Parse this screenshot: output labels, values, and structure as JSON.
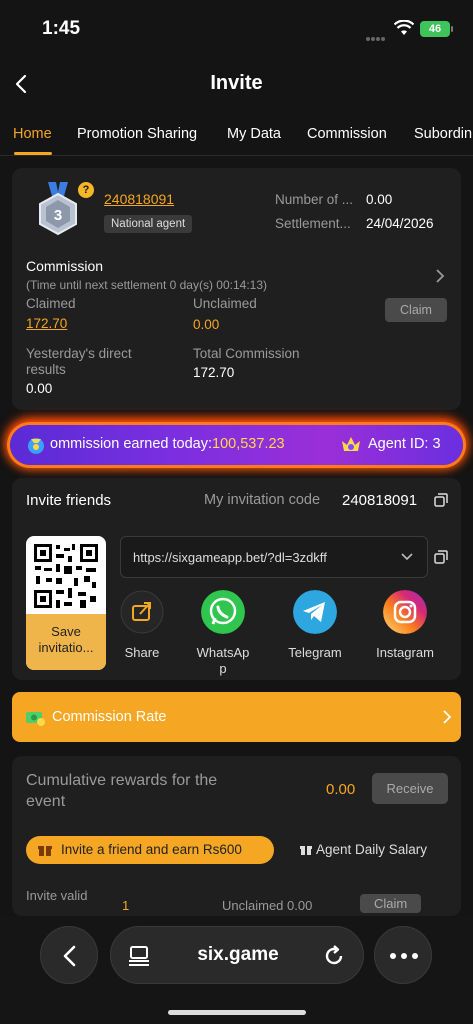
{
  "status_bar": {
    "time": "1:45",
    "battery": "46"
  },
  "header": {
    "title": "Invite"
  },
  "tabs": [
    {
      "label": "Home",
      "active": true
    },
    {
      "label": "Promotion Sharing",
      "active": false
    },
    {
      "label": "My Data",
      "active": false
    },
    {
      "label": "Commission",
      "active": false
    },
    {
      "label": "Subordin",
      "active": false
    }
  ],
  "agent": {
    "level": "3",
    "id": "240818091",
    "level_name": "National agent",
    "number_label": "Number of ...",
    "number_value": "0.00",
    "settlement_label": "Settlement...",
    "settlement_value": "24/04/2026"
  },
  "commission": {
    "title": "Commission",
    "subtitle": "(Time until next settlement 0 day(s) 00:14:13)",
    "claimed_label": "Claimed",
    "claimed_value": "172.70",
    "unclaimed_label": "Unclaimed",
    "unclaimed_value": "0.00",
    "claim_button": "Claim",
    "yesterday_label_1": "Yesterday's direct",
    "yesterday_label_2": "results",
    "yesterday_value": "0.00",
    "total_label": "Total Commission",
    "total_value": "172.70"
  },
  "banner": {
    "text": "ommission earned today:",
    "value": "100,537.23",
    "agent_text": "Agent ID: 3"
  },
  "invite": {
    "title": "Invite friends",
    "code_label": "My invitation code",
    "code": "240818091",
    "qr_save_line1": "Save",
    "qr_save_line2": "invitatio...",
    "url": "https://sixgameapp.bet/?dl=3zdkff",
    "share": [
      {
        "label": "Share",
        "icon": "share-icon"
      },
      {
        "label": "WhatsAp\np",
        "icon": "whatsapp-icon"
      },
      {
        "label": "Telegram",
        "icon": "telegram-icon"
      },
      {
        "label": "Instagram",
        "icon": "instagram-icon"
      }
    ]
  },
  "commission_rate": {
    "label": "Commission Rate"
  },
  "rewards": {
    "title": "Cumulative rewards for the event",
    "value": "0.00",
    "receive_button": "Receive",
    "earn_label": "Invite a friend and earn Rs600",
    "daily_salary": "Agent Daily Salary",
    "cut_label": "Invite valid",
    "cut_count": "1",
    "cut_unclaimed": "Unclaimed 0.00",
    "cut_claim": "Claim"
  },
  "browser": {
    "url": "six.game"
  },
  "colors": {
    "accent": "#f5a623",
    "background": "#141414",
    "card": "#1f1f1f"
  }
}
